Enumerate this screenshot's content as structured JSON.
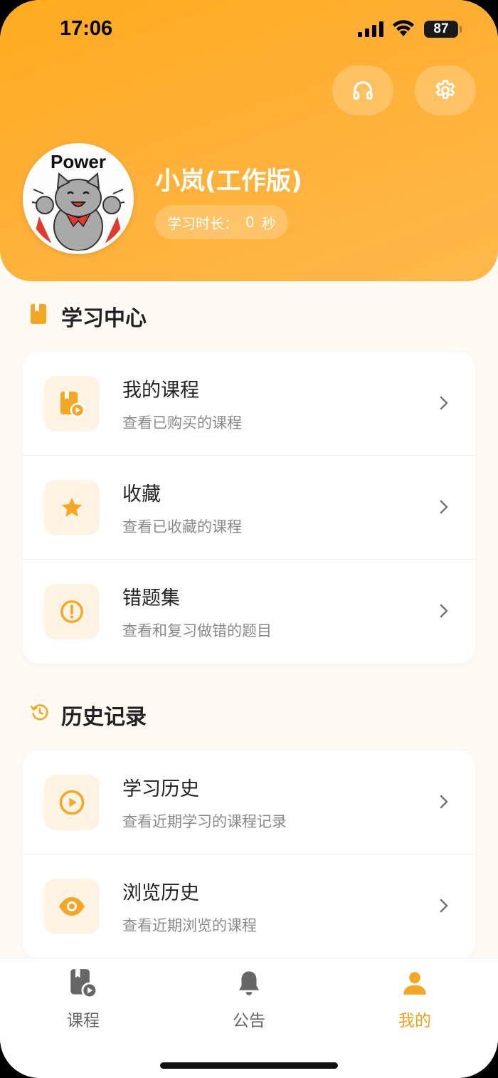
{
  "status_bar": {
    "time": "17:06",
    "battery": "87"
  },
  "header": {
    "username": "小岚(工作版)",
    "study_label": "学习时长：",
    "study_value": "0",
    "study_unit": "秒",
    "avatar_text": "Power"
  },
  "sections": {
    "learning": {
      "title": "学习中心",
      "items": [
        {
          "title": "我的课程",
          "subtitle": "查看已购买的课程"
        },
        {
          "title": "收藏",
          "subtitle": "查看已收藏的课程"
        },
        {
          "title": "错题集",
          "subtitle": "查看和复习做错的题目"
        }
      ]
    },
    "history": {
      "title": "历史记录",
      "items": [
        {
          "title": "学习历史",
          "subtitle": "查看近期学习的课程记录"
        },
        {
          "title": "浏览历史",
          "subtitle": "查看近期浏览的课程"
        }
      ]
    }
  },
  "tabbar": {
    "tabs": [
      {
        "label": "课程"
      },
      {
        "label": "公告"
      },
      {
        "label": "我的"
      }
    ]
  },
  "colors": {
    "accent": "#f5a623",
    "header": "#ffab1f",
    "bg": "#fffbf4"
  }
}
